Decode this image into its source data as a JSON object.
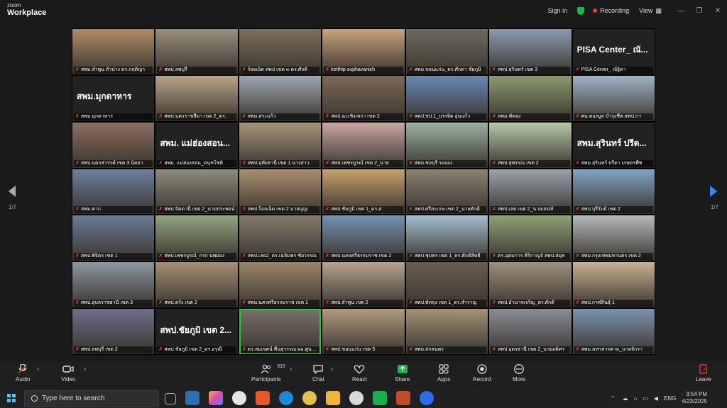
{
  "app": {
    "brand_small": "zoom",
    "brand_large": "Workplace"
  },
  "titlebar": {
    "sign_in": "Sign in",
    "recording": "Recording",
    "view": "View"
  },
  "gallery": {
    "page_left": "1/7",
    "page_right": "1/7",
    "tiles": [
      {
        "label": "สพม.ลำพูน ลำปาง ดร.กฤติญา",
        "bg": "#b08c64"
      },
      {
        "label": "สพป.ลพบุรี",
        "bg": "#9a8f7d"
      },
      {
        "label": "ร้อยเอ็ด สพป เขต ๓ ดร.ศักดิ์",
        "bg": "#7d6f5c"
      },
      {
        "label": "ketthip suphavanich",
        "bg": "#c9a27e"
      },
      {
        "label": "สพม.ขอนแก่น_ดร.ศักดา ชัยภูมิ",
        "bg": "#6e6a5f"
      },
      {
        "label": "สพป.สุรินทร์ เขต 3",
        "bg": "#8a9bb0"
      },
      {
        "label": "PISA Center_ ณัฐิดา",
        "bg": "#222222",
        "name": "PISA Center_ ณั..."
      },
      {
        "label": "สพม.มุกดาหาร",
        "bg": "#222222",
        "name": "สพม.มุกดาหาร"
      },
      {
        "label": "สพป.นครราชสีมา เขต 2_ดร.",
        "bg": "#b9a388"
      },
      {
        "label": "สพม.สระแก้ว",
        "bg": "#9ea7b2"
      },
      {
        "label": "สพป.ฉะเชิงเทรา เขต 2",
        "bg": "#7b6a55"
      },
      {
        "label": "สพป.ชป.1_บรรจิต อุ่นแก้ว",
        "bg": "#6789b3"
      },
      {
        "label": "สพม.พัทลุง",
        "bg": "#8d9a6e"
      },
      {
        "label": "ศน.ทองมูล บำรุงชีพ สพป.กา",
        "bg": "#9fb4c6"
      },
      {
        "label": "สพป.นครสวรรค์ เขต 3 นิตยา",
        "bg": "#8a6e62"
      },
      {
        "label": "สพม. แม่ฮ่องสอน_ดนุชโชติ",
        "bg": "#222222",
        "name": "สพม. แม่ฮ่องสอน..."
      },
      {
        "label": "สพป.อุทัยธานี เขต 1 นางสาว",
        "bg": "#a69479"
      },
      {
        "label": "สพป.เพชรบูรณ์ เขต 2_นาย",
        "bg": "#c9a7a0"
      },
      {
        "label": "สพม.ชลบุรี ระยอง",
        "bg": "#9db2a0"
      },
      {
        "label": "สพป.สุพรรณ เขต 2",
        "bg": "#b4c9a8"
      },
      {
        "label": "สพม.สุรินทร์ ปรีดา เกษตรพืช",
        "bg": "#222222",
        "name": "สพม.สุรินทร์ ปรีด..."
      },
      {
        "label": "สพม.ตาก",
        "bg": "#6f7fa0"
      },
      {
        "label": "สพป.ปัตตานี เขต 2_นายประพจน์",
        "bg": "#8e8d79"
      },
      {
        "label": "สพป.ร้อยเอ็ด เขต 2 นายบุญเ",
        "bg": "#a9906f"
      },
      {
        "label": "สพป.ชัยภูมิ เขต 1_ดร.ส",
        "bg": "#c7a26c"
      },
      {
        "label": "สพป.ศรีสะเกษ เขต 2_นายศักดิ์",
        "bg": "#8b8270"
      },
      {
        "label": "สพป.เลย เขต 2_นายเสน่ห์",
        "bg": "#9aa3ad"
      },
      {
        "label": "สพป.บุรีรัมย์ เขต 2",
        "bg": "#7fa4c4"
      },
      {
        "label": "สพป.พิจิตร เขต 1",
        "bg": "#6b7b96"
      },
      {
        "label": "สพป.เพชรบูรณ์_กรก นพผ่อง",
        "bg": "#93a481"
      },
      {
        "label": "สพป.เลย2_ดร.เฉลิมพร ชัยวรรณ",
        "bg": "#857a6b"
      },
      {
        "label": "สพป.นครศรีธรรมราช เขต 2",
        "bg": "#7492b2"
      },
      {
        "label": "สพป.ชุมพร เขต 1_ดร.ศักดิ์สิทธิ์",
        "bg": "#a5c0d0"
      },
      {
        "label": "ดร.อุดมการ ศิริกาญจ์ สพป.สมุท",
        "bg": "#8fa275"
      },
      {
        "label": "สพม.กรุงเทพมหานคร เขต 2",
        "bg": "#b6b9bd"
      },
      {
        "label": "สพป.อุบลราชธานี เขต 3",
        "bg": "#8c97a2"
      },
      {
        "label": "สพป.ตรัง เขต 2",
        "bg": "#a58f74"
      },
      {
        "label": "สพม.นครศรีธรรมราช เขต 1",
        "bg": "#9c8768"
      },
      {
        "label": "สพป.ลำพูน เขต 2",
        "bg": "#b6a58d"
      },
      {
        "label": "สพป.พัทลุง เขต 1_ดร.สำราญ",
        "bg": "#6a5d50"
      },
      {
        "label": "สพป.อำนาจเจริญ_ดร.ศักดิ์",
        "bg": "#9e917c"
      },
      {
        "label": "สพป.กาฬสินธุ์ 1",
        "bg": "#c8b392"
      },
      {
        "label": "สพป.ลพบุรี เขต 2",
        "bg": "#6d6f88"
      },
      {
        "label": "สพป.ชัยภูมิ เขต 2_ดร.อรุณี",
        "bg": "#222222",
        "name": "สพป.ชัยภูมิ เขต 2..."
      },
      {
        "label": "ดร.สมเจตน์ พื้นสุวรรณ ผอ.ศูนย์ PI",
        "bg": "#7a6f68",
        "highlight": true
      },
      {
        "label": "สพป.ขอนแก่น เขต 5",
        "bg": "#b29c7e"
      },
      {
        "label": "สพม.สกลนคร",
        "bg": "#a39377"
      },
      {
        "label": "สพป.อุดรธานี เขต 2_นายอดิศร",
        "bg": "#8a8d94"
      },
      {
        "label": "สพม.มหาสารคาม_นายจักรา",
        "bg": "#7d93ad"
      }
    ]
  },
  "toolbar": {
    "audio": "Audio",
    "video": "Video",
    "participants": "Participants",
    "participants_count": "315",
    "chat": "Chat",
    "react": "React",
    "share": "Share",
    "apps": "Apps",
    "record": "Record",
    "more": "More",
    "leave": "Leave"
  },
  "taskbar": {
    "search_placeholder": "Type here to search",
    "lang": "ENG",
    "time": "3:54 PM",
    "date": "4/23/2025"
  }
}
